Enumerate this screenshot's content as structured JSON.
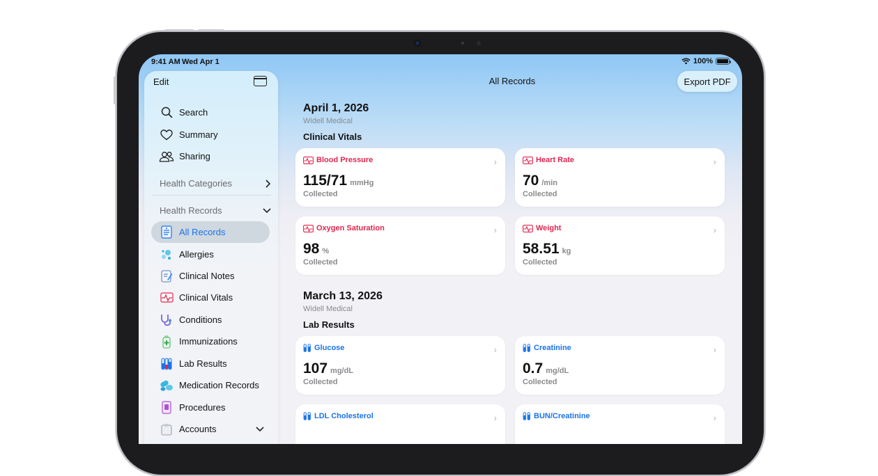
{
  "status_bar": {
    "time": "9:41 AM",
    "date": "Wed Apr 1",
    "battery": "100%"
  },
  "sidebar": {
    "edit_label": "Edit",
    "top_items": [
      {
        "label": "Search",
        "icon": "search-icon"
      },
      {
        "label": "Summary",
        "icon": "heart-icon"
      },
      {
        "label": "Sharing",
        "icon": "people-icon"
      }
    ],
    "health_categories": "Health Categories",
    "health_records": "Health Records",
    "record_items": [
      {
        "label": "All Records",
        "icon": "records-icon",
        "active": true
      },
      {
        "label": "Allergies",
        "icon": "allergies-icon"
      },
      {
        "label": "Clinical Notes",
        "icon": "notes-icon"
      },
      {
        "label": "Clinical Vitals",
        "icon": "vitals-icon"
      },
      {
        "label": "Conditions",
        "icon": "stethoscope-icon"
      },
      {
        "label": "Immunizations",
        "icon": "immunization-icon"
      },
      {
        "label": "Lab Results",
        "icon": "test-tubes-icon"
      },
      {
        "label": "Medication Records",
        "icon": "pills-icon"
      },
      {
        "label": "Procedures",
        "icon": "procedures-icon"
      }
    ],
    "accounts": "Accounts"
  },
  "header": {
    "title": "All Records",
    "export_label": "Export PDF"
  },
  "sections": [
    {
      "date": "April 1, 2026",
      "source": "Widell Medical",
      "category": "Clinical Vitals",
      "cards": [
        {
          "label": "Blood Pressure",
          "value": "115/71",
          "unit": "mmHg",
          "status": "Collected"
        },
        {
          "label": "Heart Rate",
          "value": "70",
          "unit": "/min",
          "status": "Collected"
        },
        {
          "label": "Oxygen Saturation",
          "value": "98",
          "unit": "%",
          "status": "Collected"
        },
        {
          "label": "Weight",
          "value": "58.51",
          "unit": "kg",
          "status": "Collected"
        }
      ]
    },
    {
      "date": "March 13, 2026",
      "source": "Widell Medical",
      "category": "Lab Results",
      "cards": [
        {
          "label": "Glucose",
          "value": "107",
          "unit": "mg/dL",
          "status": "Collected"
        },
        {
          "label": "Creatinine",
          "value": "0.7",
          "unit": "mg/dL",
          "status": "Collected"
        },
        {
          "label": "LDL Cholesterol"
        },
        {
          "label": "BUN/Creatinine"
        }
      ]
    }
  ],
  "colors": {
    "vitals_accent": "#e0264e",
    "lab_accent": "#1a73e8",
    "active_item": "#1a73e8"
  }
}
